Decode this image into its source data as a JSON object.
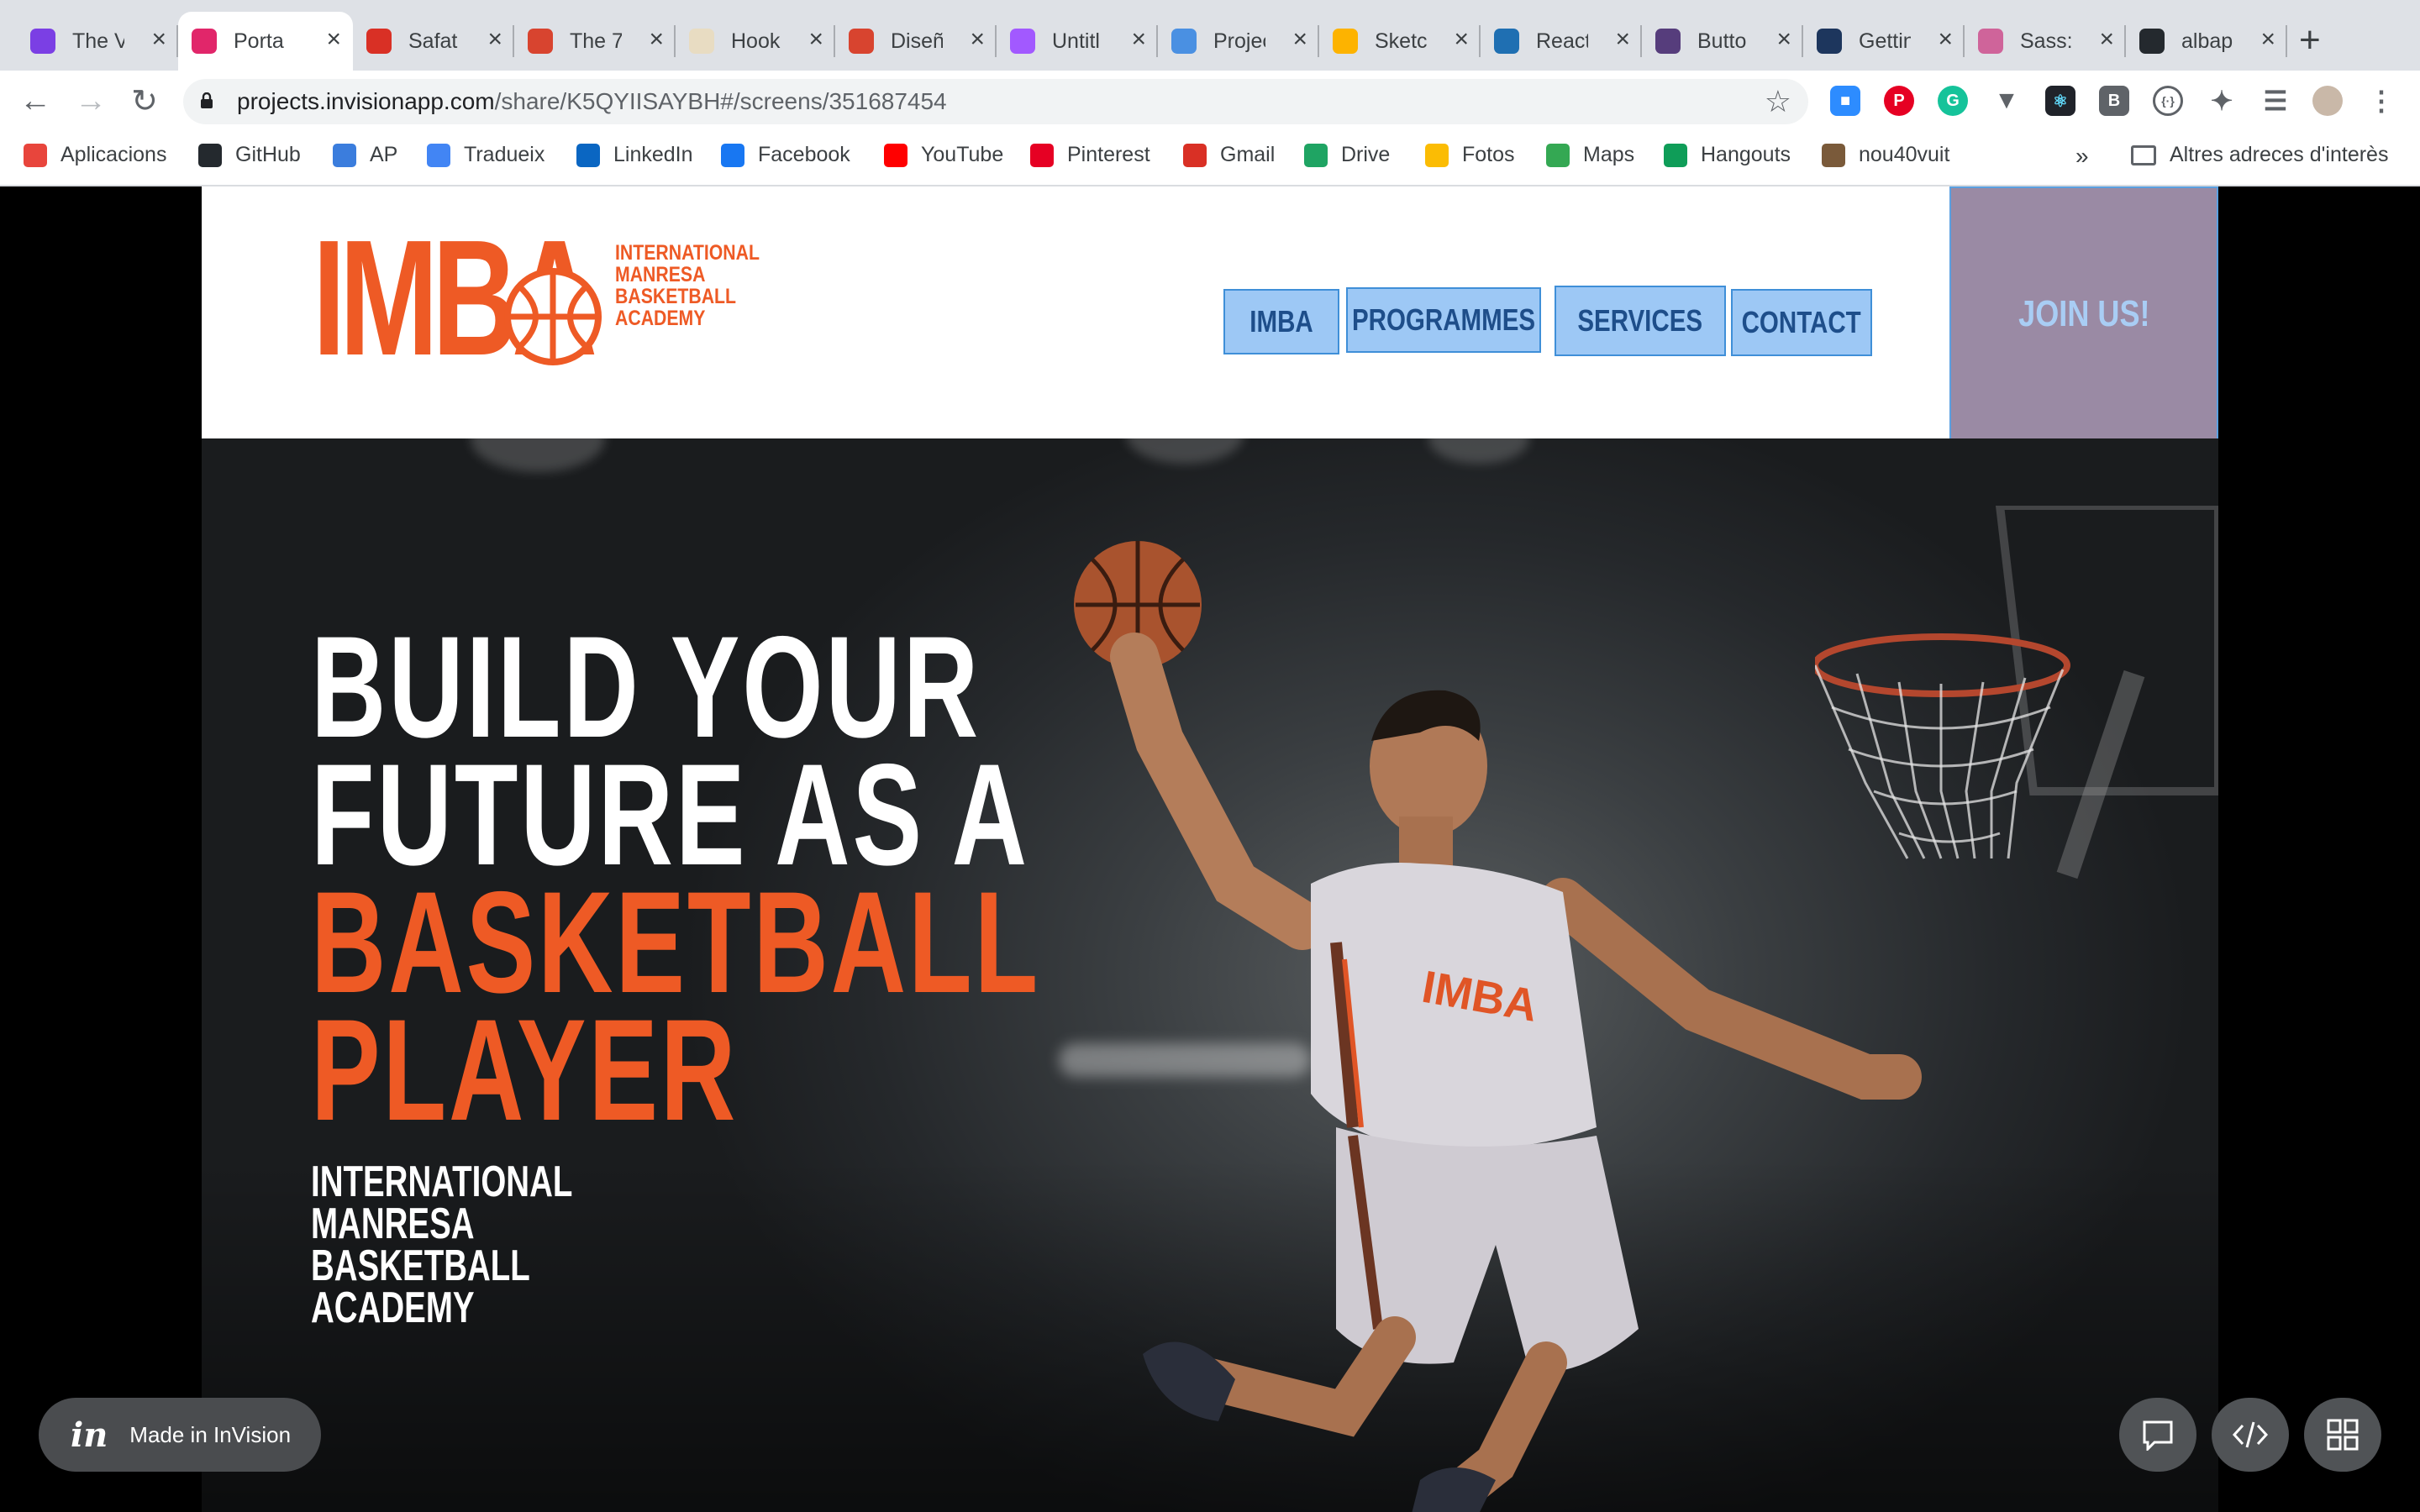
{
  "browser": {
    "tabs": [
      {
        "title": "The V",
        "icon": "dribbble-like-icon",
        "color": "#7b3fe4"
      },
      {
        "title": "Porta",
        "icon": "invision-icon",
        "color": "#e1266a",
        "active": true
      },
      {
        "title": "Safat",
        "icon": "gmail-icon",
        "color": "#d93025"
      },
      {
        "title": "The 7",
        "icon": "ux-icon",
        "color": "#d8442f"
      },
      {
        "title": "Hook",
        "icon": "goodreads-icon",
        "color": "#e8dcc2"
      },
      {
        "title": "Diseñ",
        "icon": "itdo-icon",
        "color": "#d8442f"
      },
      {
        "title": "Untitl",
        "icon": "figma-icon",
        "color": "#a259ff"
      },
      {
        "title": "Projec",
        "icon": "f-icon",
        "color": "#4a90e2"
      },
      {
        "title": "Sketc",
        "icon": "sketch-icon",
        "color": "#fdb300"
      },
      {
        "title": "React",
        "icon": "react-icon",
        "color": "#1f6fb2"
      },
      {
        "title": "Butto",
        "icon": "bootstrap-icon",
        "color": "#563d7c"
      },
      {
        "title": "Gettin",
        "icon": "less-icon",
        "color": "#1d365d"
      },
      {
        "title": "Sass:",
        "icon": "sass-icon",
        "color": "#cf649a"
      },
      {
        "title": "albap",
        "icon": "github-icon",
        "color": "#24292e"
      }
    ],
    "address": {
      "host": "projects.invisionapp.com",
      "path": "/share/K5QYIISAYBH#/screens/351687454"
    },
    "bookmarks": [
      {
        "label": "Aplicacions",
        "icon": "apps-grid-icon",
        "color": "#e8453c"
      },
      {
        "label": "GitHub",
        "icon": "github-icon",
        "color": "#24292e"
      },
      {
        "label": "AP",
        "icon": "wix-icon",
        "color": "#3b7ddd"
      },
      {
        "label": "Tradueix",
        "icon": "translate-icon",
        "color": "#4285f4"
      },
      {
        "label": "LinkedIn",
        "icon": "linkedin-icon",
        "color": "#0a66c2"
      },
      {
        "label": "Facebook",
        "icon": "facebook-icon",
        "color": "#1877f2"
      },
      {
        "label": "YouTube",
        "icon": "youtube-icon",
        "color": "#ff0000"
      },
      {
        "label": "Pinterest",
        "icon": "pinterest-icon",
        "color": "#e60023"
      },
      {
        "label": "Gmail",
        "icon": "gmail-icon",
        "color": "#d93025"
      },
      {
        "label": "Drive",
        "icon": "drive-icon",
        "color": "#1fa463"
      },
      {
        "label": "Fotos",
        "icon": "photos-icon",
        "color": "#fbbc04"
      },
      {
        "label": "Maps",
        "icon": "maps-icon",
        "color": "#34a853"
      },
      {
        "label": "Hangouts",
        "icon": "hangouts-icon",
        "color": "#0f9d58"
      },
      {
        "label": "nou40vuit",
        "icon": "site-icon",
        "color": "#7a5a3a"
      }
    ],
    "more_bookmarks": "»",
    "other_bookmarks": "Altres adreces d'interès"
  },
  "site": {
    "logo": {
      "letters": "IMBA",
      "lines": [
        "INTERNATIONAL",
        "MANRESA",
        "BASKETBALL",
        "ACADEMY"
      ]
    },
    "nav": [
      "IMBA",
      "PROGRAMMES",
      "SERVICES",
      "CONTACT"
    ],
    "cta": "JOIN US!",
    "hero": {
      "line1": "BUILD YOUR",
      "line2": "FUTURE AS A",
      "line3": "BASKETBALL",
      "line4": "PLAYER",
      "sub": [
        "INTERNATIONAL",
        "MANRESA",
        "BASKETBALL",
        "ACADEMY"
      ],
      "jersey": "IMBA"
    },
    "colors": {
      "brand_orange": "#ee5a25",
      "nav_bg": "#9dc8f5",
      "nav_text": "#1e4e8a",
      "cta_bg": "#9a8aa4"
    }
  },
  "invision": {
    "badge": "Made in InVision",
    "badge_logo": "in"
  }
}
